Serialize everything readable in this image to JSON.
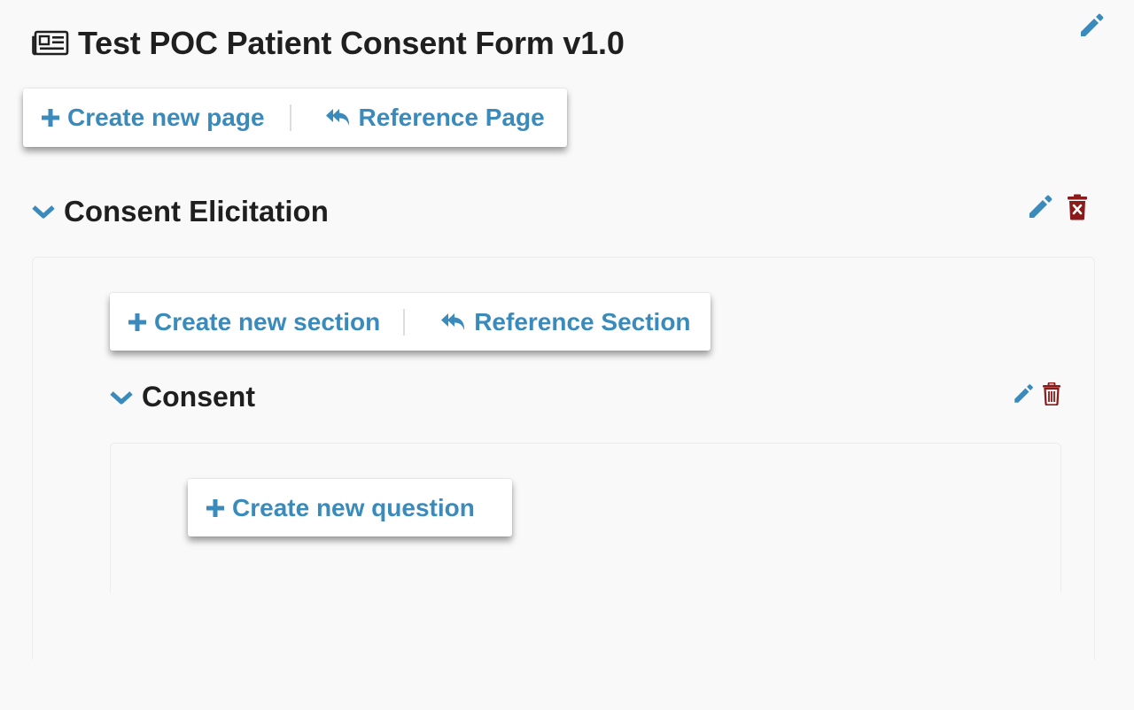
{
  "form": {
    "title": "Test POC Patient Consent Form v1.0",
    "title_icon": "newspaper-icon",
    "edit_icon": "pencil-icon"
  },
  "page_toolbar": {
    "create_label": "Create new page",
    "create_icon": "plus-icon",
    "reference_label": "Reference Page",
    "reference_icon": "reply-all-icon"
  },
  "page": {
    "title": "Consent Elicitation",
    "expand_icon": "chevron-down-icon",
    "edit_icon": "pencil-icon",
    "delete_icon": "trash-x-icon"
  },
  "section_toolbar": {
    "create_label": "Create new section",
    "create_icon": "plus-icon",
    "reference_label": "Reference Section",
    "reference_icon": "reply-all-icon"
  },
  "section": {
    "title": "Consent",
    "expand_icon": "chevron-down-icon",
    "edit_icon": "pencil-icon",
    "delete_icon": "trash-icon"
  },
  "question_toolbar": {
    "create_label": "Create new question",
    "create_icon": "plus-icon"
  },
  "colors": {
    "accent_blue": "#3a8bbb",
    "danger_red": "#8b1a1a",
    "title_text": "#1f1f1f",
    "background": "#f9f9f9"
  }
}
